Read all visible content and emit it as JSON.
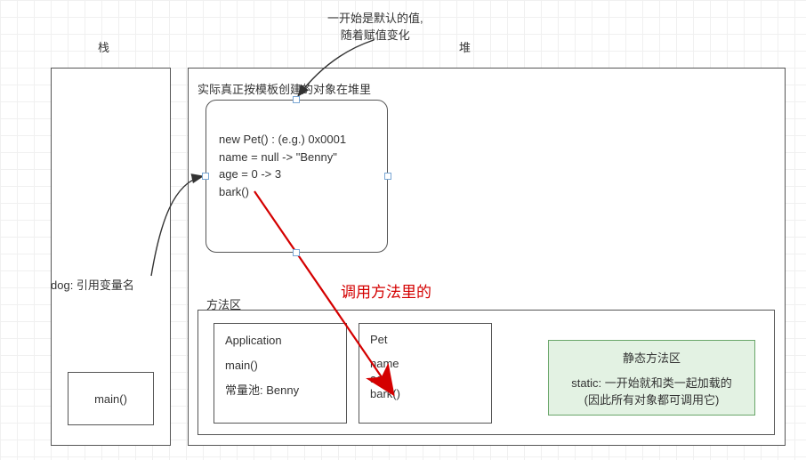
{
  "labels": {
    "stack": "栈",
    "heap": "堆",
    "topNote1": "一开始是默认的值,",
    "topNote2": "随着赋值变化",
    "heapObjTitle": "实际真正按模板创建的对象在堆里",
    "objLine1": "new Pet() : (e.g.) 0x0001",
    "objLine2": "name = null -> \"Benny\"",
    "objLine3": "age = 0 -> 3",
    "objLine4": "bark()",
    "dogRef": "dog: 引用变量名",
    "mainBox": "main()",
    "methodArea": "方法区",
    "callMethod": "调用方法里的",
    "appTitle": "Application",
    "appMain": "main()",
    "appConstPool": "常量池:  Benny",
    "petTitle": "Pet",
    "petName": "name",
    "petAge": "age",
    "petBark": "bark()",
    "staticTitle": "静态方法区",
    "staticLine1": "static: 一开始就和类一起加载的",
    "staticLine2": "(因此所有对象都可调用它)"
  }
}
